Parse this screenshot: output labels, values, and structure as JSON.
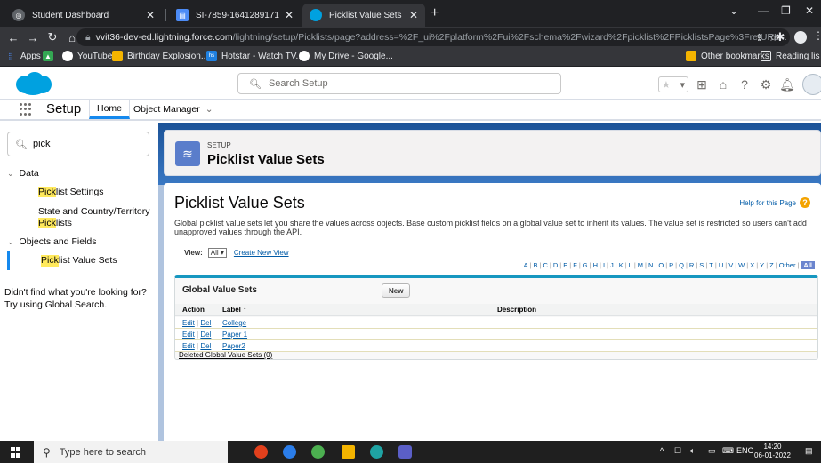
{
  "browser": {
    "tabs": [
      {
        "title": "Student Dashboard"
      },
      {
        "title": "SI-7859-1641289171"
      },
      {
        "title": "Picklist Value Sets | Salesforce"
      }
    ],
    "new_tab": "+",
    "address": {
      "host": "vvit36-dev-ed.lightning.force.com",
      "path": "/lightning/setup/Picklists/page?address=%2F_ui%2Fplatform%2Fui%2Fschema%2Fwizard%2Fpicklist%2FPicklistsPage%3FretURL..."
    },
    "bookmarks": [
      {
        "label": "Apps"
      },
      {
        "label": "YouTube"
      },
      {
        "label": "Birthday Explosion..."
      },
      {
        "label": "Hotstar - Watch TV..."
      },
      {
        "label": "My Drive - Google..."
      },
      {
        "label": "Other bookmarks"
      },
      {
        "label": "Reading lis"
      }
    ]
  },
  "header": {
    "search_placeholder": "Search Setup"
  },
  "nav": {
    "app_name": "Setup",
    "tabs": [
      {
        "label": "Home"
      },
      {
        "label": "Object Manager"
      }
    ]
  },
  "sidebar": {
    "quick_find_value": "pick",
    "groups": [
      {
        "label": "Data"
      },
      {
        "label": "Objects and Fields"
      }
    ],
    "items": [
      {
        "match": "Pick",
        "rest": "list Settings"
      },
      {
        "prefix": "State and Country/Territory",
        "match": "Pick",
        "rest": "lists"
      },
      {
        "match": "Pick",
        "rest": "list Value Sets"
      }
    ],
    "help_text": "Didn't find what you're looking for? Try using Global Search."
  },
  "page_header": {
    "eyebrow": "SETUP",
    "title": "Picklist Value Sets"
  },
  "content": {
    "title": "Picklist Value Sets",
    "help_link": "Help for this Page",
    "description": "Global picklist value sets let you share the values across objects. Base custom picklist fields on a global value set to inherit its values. The value set is restricted so users can't add unapproved values through the API.",
    "view_label": "View:",
    "view_value": "All",
    "create_view": "Create New View",
    "alpha_filter": [
      "A",
      "B",
      "C",
      "D",
      "E",
      "F",
      "G",
      "H",
      "I",
      "J",
      "K",
      "L",
      "M",
      "N",
      "O",
      "P",
      "Q",
      "R",
      "S",
      "T",
      "U",
      "V",
      "W",
      "X",
      "Y",
      "Z",
      "Other",
      "All"
    ],
    "list": {
      "title": "Global Value Sets",
      "new_button": "New",
      "columns": [
        "Action",
        "Label ↑",
        "Description"
      ],
      "rows": [
        {
          "edit": "Edit",
          "del": "Del",
          "label": "College",
          "description": ""
        },
        {
          "edit": "Edit",
          "del": "Del",
          "label": "Paper 1",
          "description": ""
        },
        {
          "edit": "Edit",
          "del": "Del",
          "label": "Paper2",
          "description": ""
        }
      ],
      "deleted_link": "Deleted Global Value Sets (0)"
    }
  },
  "taskbar": {
    "search_placeholder": "Type here to search",
    "lang": "ENG",
    "time": "14:20",
    "date": "06-01-2022"
  },
  "colors": {
    "brand": "#00a1e0",
    "active_tab_underline": "#1589ee",
    "highlight": "#ffe95c",
    "link": "#015ba7"
  }
}
